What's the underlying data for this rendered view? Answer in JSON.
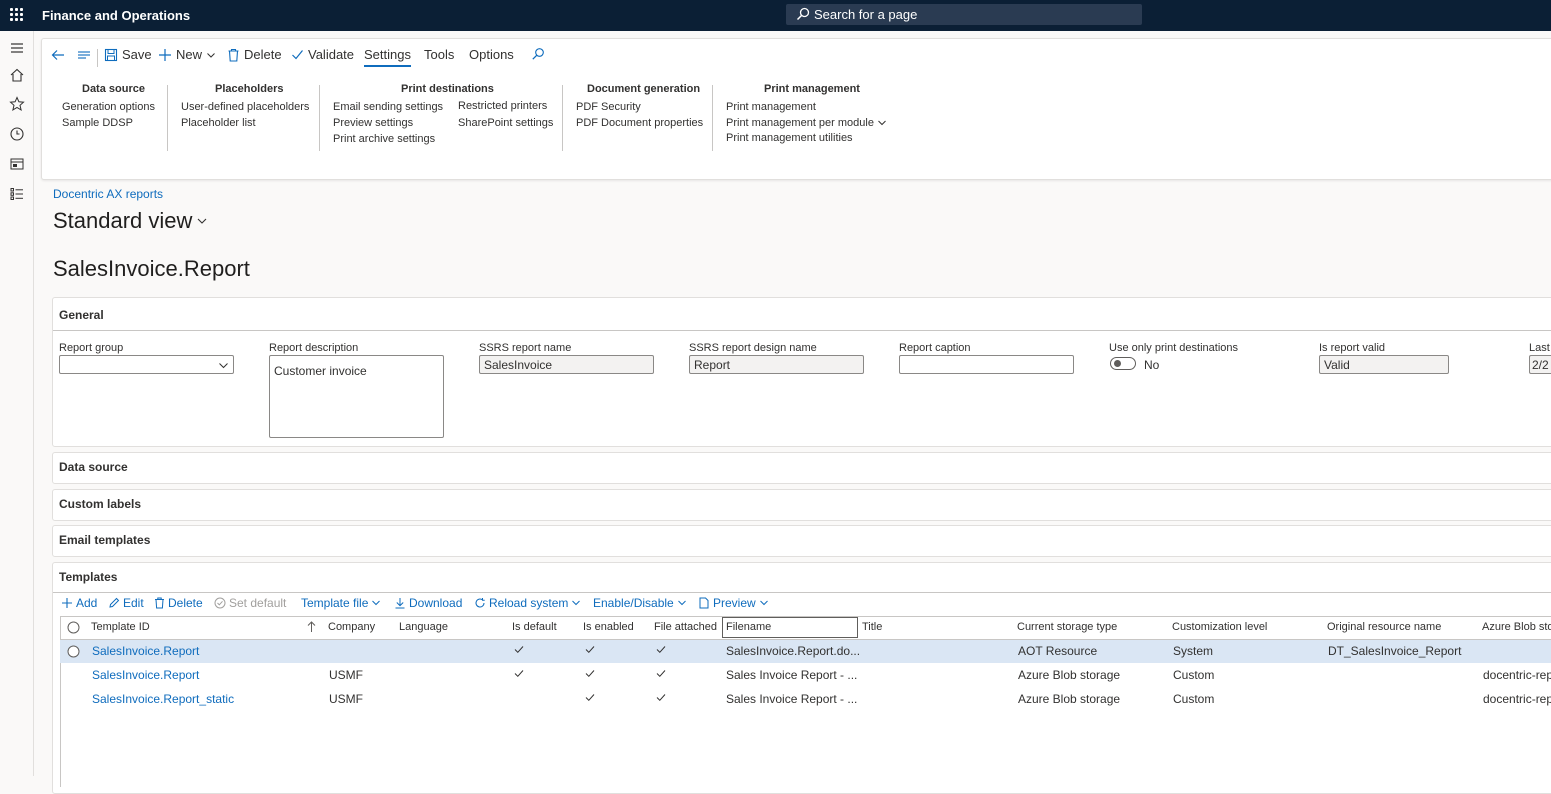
{
  "app": {
    "title": "Finance and Operations"
  },
  "search": {
    "placeholder": "Search for a page"
  },
  "toolbar": {
    "save": "Save",
    "new": "New",
    "delete": "Delete",
    "validate": "Validate",
    "tabs": [
      "Settings",
      "Tools",
      "Options"
    ],
    "active_tab": "Settings"
  },
  "ribbon": {
    "data_source": {
      "title": "Data source",
      "items": [
        "Generation options",
        "Sample DDSP"
      ]
    },
    "placeholders": {
      "title": "Placeholders",
      "items": [
        "User-defined placeholders",
        "Placeholder list"
      ]
    },
    "print_destinations": {
      "title": "Print destinations",
      "items": [
        "Email sending settings",
        "Preview settings",
        "Print archive settings",
        "Restricted printers",
        "SharePoint settings"
      ]
    },
    "document_generation": {
      "title": "Document generation",
      "items": [
        "PDF Security",
        "PDF Document properties"
      ]
    },
    "print_management": {
      "title": "Print management",
      "items": [
        "Print management",
        "Print management per module",
        "Print management utilities"
      ]
    }
  },
  "breadcrumb": "Docentric AX reports",
  "view_name": "Standard view",
  "record_title": "SalesInvoice.Report",
  "general": {
    "title": "General",
    "fields": {
      "report_group": {
        "label": "Report group",
        "value": ""
      },
      "report_description": {
        "label": "Report description",
        "value": "Customer invoice"
      },
      "ssrs_report_name": {
        "label": "SSRS report name",
        "value": "SalesInvoice"
      },
      "ssrs_design_name": {
        "label": "SSRS report design name",
        "value": "Report"
      },
      "report_caption": {
        "label": "Report caption",
        "value": ""
      },
      "use_only_print_destinations": {
        "label": "Use only print destinations",
        "value": "No"
      },
      "is_report_valid": {
        "label": "Is report valid",
        "value": "Valid"
      },
      "last": {
        "label": "Last",
        "value": "2/2"
      }
    }
  },
  "sections": {
    "data_source": "Data source",
    "custom_labels": "Custom labels",
    "email_templates": "Email templates",
    "templates": "Templates"
  },
  "template_actions": {
    "add": "Add",
    "edit": "Edit",
    "delete": "Delete",
    "set_default": "Set default",
    "template_file": "Template file",
    "download": "Download",
    "reload_system": "Reload system",
    "enable_disable": "Enable/Disable",
    "preview": "Preview"
  },
  "grid": {
    "columns": [
      "Template ID",
      "Company",
      "Language",
      "Is default",
      "Is enabled",
      "File attached",
      "Filename",
      "Title",
      "Current storage type",
      "Customization level",
      "Original resource name",
      "Azure Blob sto"
    ],
    "rows": [
      {
        "template_id": "SalesInvoice.Report",
        "company": "",
        "language": "",
        "is_default": true,
        "is_enabled": true,
        "file_attached": true,
        "filename": "SalesInvoice.Report.do...",
        "title": "",
        "storage": "AOT Resource",
        "customization": "System",
        "original": "DT_SalesInvoice_Report",
        "azure": ""
      },
      {
        "template_id": "SalesInvoice.Report",
        "company": "USMF",
        "language": "",
        "is_default": true,
        "is_enabled": true,
        "file_attached": true,
        "filename": "Sales Invoice Report - ...",
        "title": "",
        "storage": "Azure Blob storage",
        "customization": "Custom",
        "original": "",
        "azure": "docentric-rep"
      },
      {
        "template_id": "SalesInvoice.Report_static",
        "company": "USMF",
        "language": "",
        "is_default": false,
        "is_enabled": true,
        "file_attached": true,
        "filename": "Sales Invoice Report - ...",
        "title": "",
        "storage": "Azure Blob storage",
        "customization": "Custom",
        "original": "",
        "azure": "docentric-rep"
      }
    ]
  },
  "colors": {
    "topbar": "#0b1f35",
    "accent": "#0f6cbd",
    "selected_row": "#dae6f4"
  }
}
